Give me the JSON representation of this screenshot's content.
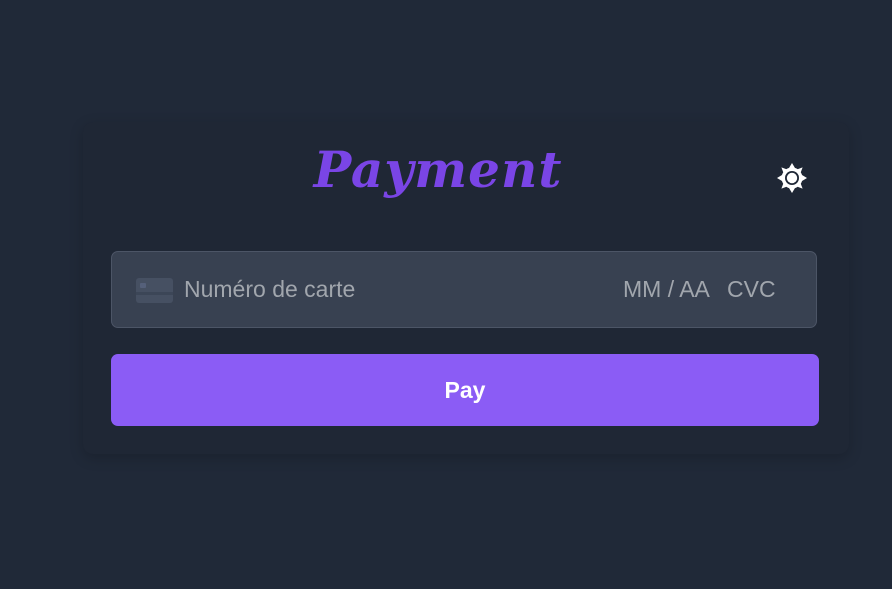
{
  "header": {
    "title": "Payment",
    "theme_toggle_icon": "sun-icon"
  },
  "payment_form": {
    "card_icon": "credit-card-icon",
    "card_number_placeholder": "Numéro de carte",
    "expiry_placeholder": "MM / AA",
    "cvc_placeholder": "CVC",
    "pay_label": "Pay"
  },
  "colors": {
    "background": "#202938",
    "card": "#1f2735",
    "accent": "#8b5cf5",
    "title": "#7a45e6",
    "input_bg": "#384151",
    "placeholder": "#a1a6ad"
  }
}
